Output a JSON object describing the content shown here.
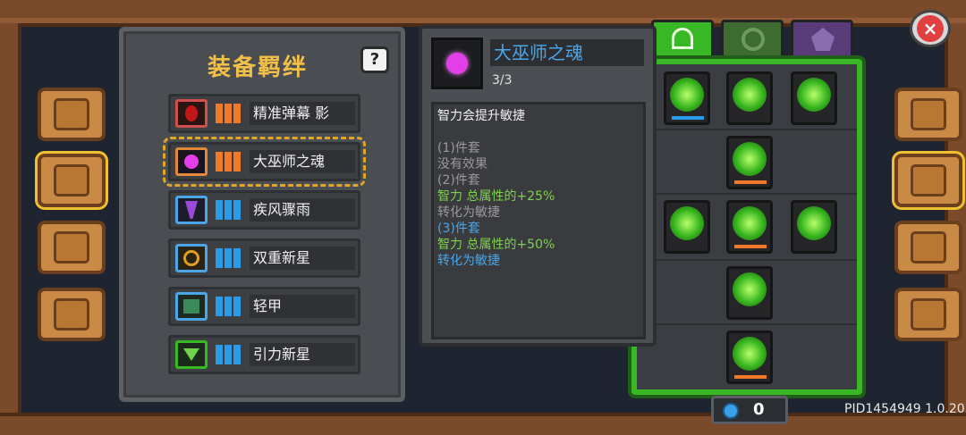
{
  "colors": {
    "title": "#f3c047",
    "wood": "#7a4a2a",
    "tree_border": "#38b824",
    "bar_orange": "#f07a2a",
    "bar_blue": "#2a9be8",
    "desc_gray": "#9a9a9a",
    "desc_green": "#7ed24a",
    "desc_blue": "#4aa6e8"
  },
  "side_tabs_left": [
    {
      "icon": "book-icon"
    },
    {
      "icon": "scroll-icon",
      "active": true
    },
    {
      "icon": "stones-icon"
    },
    {
      "icon": "helmet-icon"
    }
  ],
  "side_tabs_right": [
    {
      "icon": "helmet-icon"
    },
    {
      "icon": "upgrade-sword-icon",
      "active": true
    },
    {
      "icon": "compass-icon"
    },
    {
      "icon": "gear-icon"
    }
  ],
  "panel": {
    "title": "装备羁绊",
    "help": "?"
  },
  "sets": [
    {
      "label": "精准弹幕 影",
      "bar_color": "orange",
      "icon": "shadow-flame-icon"
    },
    {
      "label": "大巫师之魂",
      "bar_color": "orange",
      "icon": "purple-soul-icon",
      "selected": true
    },
    {
      "label": "疾风骤雨",
      "bar_color": "blue",
      "icon": "tornado-icon"
    },
    {
      "label": "双重新星",
      "bar_color": "blue",
      "icon": "double-ring-icon"
    },
    {
      "label": "轻甲",
      "bar_color": "blue",
      "icon": "armor-icon"
    },
    {
      "label": "引力新星",
      "bar_color": "blue",
      "icon": "gravity-icon"
    }
  ],
  "detail": {
    "name": "大巫师之魂",
    "count": "3/3",
    "lines": [
      {
        "text": "智力会提升敏捷",
        "style": "white"
      },
      {
        "text": "",
        "style": "gap"
      },
      {
        "text": "(1)件套",
        "style": "gray"
      },
      {
        "text": "没有效果",
        "style": "gray"
      },
      {
        "text": "(2)件套",
        "style": "gray"
      },
      {
        "text": "智力 总属性的+25%",
        "style": "green"
      },
      {
        "text": "转化为敏捷",
        "style": "gray"
      },
      {
        "text": "(3)件套",
        "style": "blue"
      },
      {
        "text": "智力 总属性的+50%",
        "style": "green"
      },
      {
        "text": "转化为敏捷",
        "style": "blue"
      }
    ]
  },
  "tree_tabs": [
    {
      "icon": "bow-icon",
      "active": true
    },
    {
      "icon": "ring-icon"
    },
    {
      "icon": "crest-icon"
    }
  ],
  "skills": [
    {
      "icon": "target-skill-icon",
      "pips": "blue"
    },
    {
      "icon": "swirl-skill-icon",
      "pips": "none"
    },
    {
      "icon": "heal-skill-icon",
      "pips": "none"
    },
    {
      "icon": "impact-skill-icon",
      "pips": "orange"
    },
    {
      "icon": "dash-skill-icon",
      "pips": "none"
    },
    {
      "icon": "up-arrow-skill-icon",
      "pips": "orange"
    },
    {
      "icon": "shield-skill-icon",
      "pips": "none"
    },
    {
      "icon": "slash-skill-icon",
      "pips": "none"
    },
    {
      "icon": "tech-skill-icon",
      "pips": "orange"
    }
  ],
  "currency": {
    "amount": "0",
    "icon": "gem-icon"
  },
  "version": "PID1454949 1.0.20",
  "close": "×"
}
